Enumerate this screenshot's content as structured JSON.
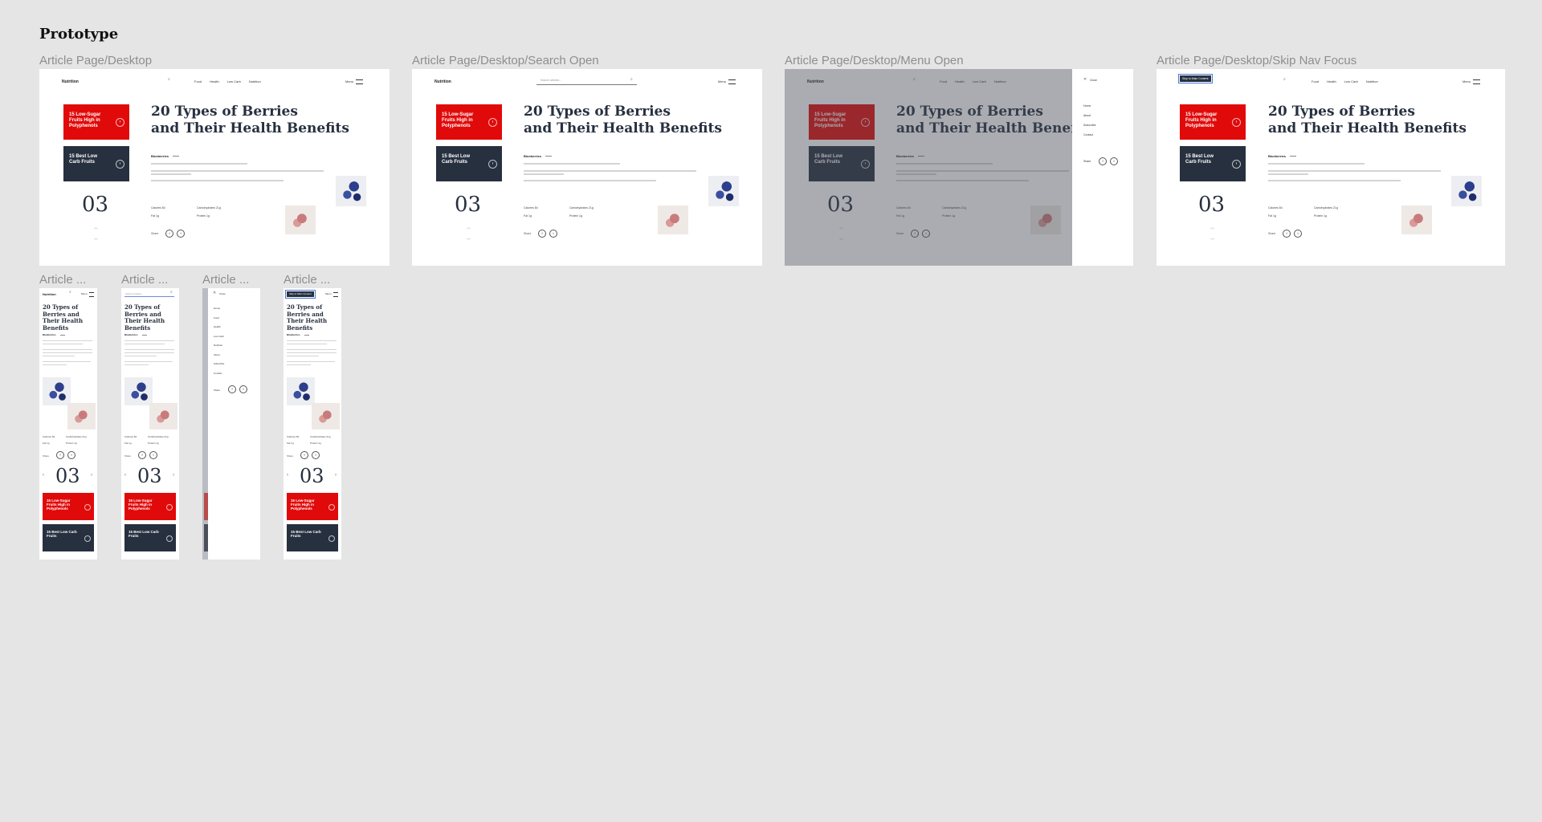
{
  "page": {
    "title": "Prototype"
  },
  "brand": {
    "accent": "#e10a0a",
    "dark": "#27303f",
    "background": "#e5e5e5"
  },
  "frames": {
    "desktop": "Article Page/Desktop",
    "desktop_search": "Article Page/Desktop/Search Open",
    "desktop_menu": "Article Page/Desktop/Menu Open",
    "desktop_skip": "Article Page/Desktop/Skip Nav Focus",
    "mobile_1": "Article ...",
    "mobile_2": "Article ...",
    "mobile_3": "Article ...",
    "mobile_4": "Article ..."
  },
  "article": {
    "logo": "Nutrition",
    "nav": [
      "Food",
      "Health",
      "Low Carb",
      "Nutrition"
    ],
    "menu_label": "Menu",
    "headline_line1": "20 Types of Berries",
    "headline_line2": "and Their Health Benefits",
    "category": "Blueberries",
    "counter": "03",
    "card_red": "15 Low-Sugar Fruits High in Polyphenols",
    "card_dark": "15 Best Low Carb Fruits",
    "stats": {
      "calories": "Calories 84",
      "carbs": "Carbohydrates 21g",
      "fat": "Fat 1g",
      "protein": "Protein 1g"
    },
    "share_label": "Share",
    "social": [
      "f",
      "t"
    ],
    "search_placeholder": "Search articles...",
    "skip_label": "Skip to Main Content",
    "close_label": "Close",
    "side_menu": [
      "Home",
      "About",
      "Subscribe",
      "Contact"
    ],
    "mobile_menu": [
      "Home",
      "Food",
      "Health",
      "Low Carb",
      "Nutrition",
      "About",
      "Subscribe",
      "Contact"
    ]
  },
  "icons": {
    "search": "search-icon",
    "menu": "hamburger-icon",
    "close": "close-icon",
    "arrow_up": "chevron-up-icon",
    "arrow_down": "chevron-down-icon"
  }
}
